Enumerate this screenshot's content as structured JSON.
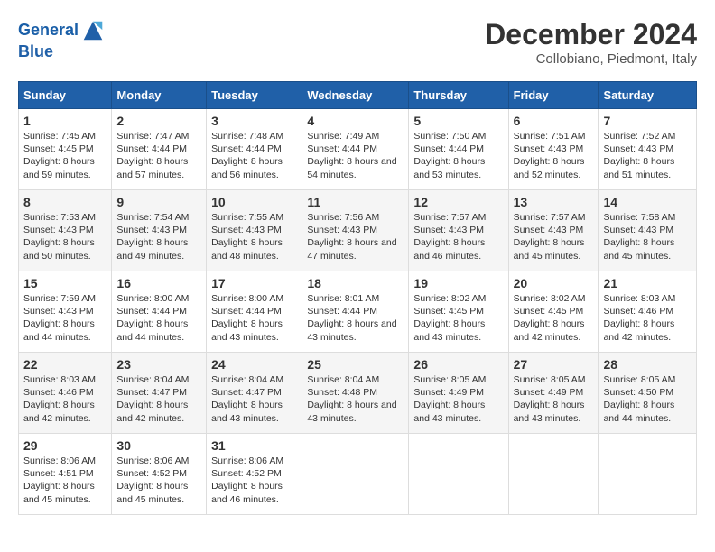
{
  "header": {
    "logo_line1": "General",
    "logo_line2": "Blue",
    "month_title": "December 2024",
    "location": "Collobiano, Piedmont, Italy"
  },
  "columns": [
    "Sunday",
    "Monday",
    "Tuesday",
    "Wednesday",
    "Thursday",
    "Friday",
    "Saturday"
  ],
  "weeks": [
    [
      {
        "day": "1",
        "sunrise": "7:45 AM",
        "sunset": "4:45 PM",
        "daylight": "8 hours and 59 minutes."
      },
      {
        "day": "2",
        "sunrise": "7:47 AM",
        "sunset": "4:44 PM",
        "daylight": "8 hours and 57 minutes."
      },
      {
        "day": "3",
        "sunrise": "7:48 AM",
        "sunset": "4:44 PM",
        "daylight": "8 hours and 56 minutes."
      },
      {
        "day": "4",
        "sunrise": "7:49 AM",
        "sunset": "4:44 PM",
        "daylight": "8 hours and 54 minutes."
      },
      {
        "day": "5",
        "sunrise": "7:50 AM",
        "sunset": "4:44 PM",
        "daylight": "8 hours and 53 minutes."
      },
      {
        "day": "6",
        "sunrise": "7:51 AM",
        "sunset": "4:43 PM",
        "daylight": "8 hours and 52 minutes."
      },
      {
        "day": "7",
        "sunrise": "7:52 AM",
        "sunset": "4:43 PM",
        "daylight": "8 hours and 51 minutes."
      }
    ],
    [
      {
        "day": "8",
        "sunrise": "7:53 AM",
        "sunset": "4:43 PM",
        "daylight": "8 hours and 50 minutes."
      },
      {
        "day": "9",
        "sunrise": "7:54 AM",
        "sunset": "4:43 PM",
        "daylight": "8 hours and 49 minutes."
      },
      {
        "day": "10",
        "sunrise": "7:55 AM",
        "sunset": "4:43 PM",
        "daylight": "8 hours and 48 minutes."
      },
      {
        "day": "11",
        "sunrise": "7:56 AM",
        "sunset": "4:43 PM",
        "daylight": "8 hours and 47 minutes."
      },
      {
        "day": "12",
        "sunrise": "7:57 AM",
        "sunset": "4:43 PM",
        "daylight": "8 hours and 46 minutes."
      },
      {
        "day": "13",
        "sunrise": "7:57 AM",
        "sunset": "4:43 PM",
        "daylight": "8 hours and 45 minutes."
      },
      {
        "day": "14",
        "sunrise": "7:58 AM",
        "sunset": "4:43 PM",
        "daylight": "8 hours and 45 minutes."
      }
    ],
    [
      {
        "day": "15",
        "sunrise": "7:59 AM",
        "sunset": "4:43 PM",
        "daylight": "8 hours and 44 minutes."
      },
      {
        "day": "16",
        "sunrise": "8:00 AM",
        "sunset": "4:44 PM",
        "daylight": "8 hours and 44 minutes."
      },
      {
        "day": "17",
        "sunrise": "8:00 AM",
        "sunset": "4:44 PM",
        "daylight": "8 hours and 43 minutes."
      },
      {
        "day": "18",
        "sunrise": "8:01 AM",
        "sunset": "4:44 PM",
        "daylight": "8 hours and 43 minutes."
      },
      {
        "day": "19",
        "sunrise": "8:02 AM",
        "sunset": "4:45 PM",
        "daylight": "8 hours and 43 minutes."
      },
      {
        "day": "20",
        "sunrise": "8:02 AM",
        "sunset": "4:45 PM",
        "daylight": "8 hours and 42 minutes."
      },
      {
        "day": "21",
        "sunrise": "8:03 AM",
        "sunset": "4:46 PM",
        "daylight": "8 hours and 42 minutes."
      }
    ],
    [
      {
        "day": "22",
        "sunrise": "8:03 AM",
        "sunset": "4:46 PM",
        "daylight": "8 hours and 42 minutes."
      },
      {
        "day": "23",
        "sunrise": "8:04 AM",
        "sunset": "4:47 PM",
        "daylight": "8 hours and 42 minutes."
      },
      {
        "day": "24",
        "sunrise": "8:04 AM",
        "sunset": "4:47 PM",
        "daylight": "8 hours and 43 minutes."
      },
      {
        "day": "25",
        "sunrise": "8:04 AM",
        "sunset": "4:48 PM",
        "daylight": "8 hours and 43 minutes."
      },
      {
        "day": "26",
        "sunrise": "8:05 AM",
        "sunset": "4:49 PM",
        "daylight": "8 hours and 43 minutes."
      },
      {
        "day": "27",
        "sunrise": "8:05 AM",
        "sunset": "4:49 PM",
        "daylight": "8 hours and 43 minutes."
      },
      {
        "day": "28",
        "sunrise": "8:05 AM",
        "sunset": "4:50 PM",
        "daylight": "8 hours and 44 minutes."
      }
    ],
    [
      {
        "day": "29",
        "sunrise": "8:06 AM",
        "sunset": "4:51 PM",
        "daylight": "8 hours and 45 minutes."
      },
      {
        "day": "30",
        "sunrise": "8:06 AM",
        "sunset": "4:52 PM",
        "daylight": "8 hours and 45 minutes."
      },
      {
        "day": "31",
        "sunrise": "8:06 AM",
        "sunset": "4:52 PM",
        "daylight": "8 hours and 46 minutes."
      },
      null,
      null,
      null,
      null
    ]
  ],
  "labels": {
    "sunrise": "Sunrise:",
    "sunset": "Sunset:",
    "daylight": "Daylight:"
  }
}
